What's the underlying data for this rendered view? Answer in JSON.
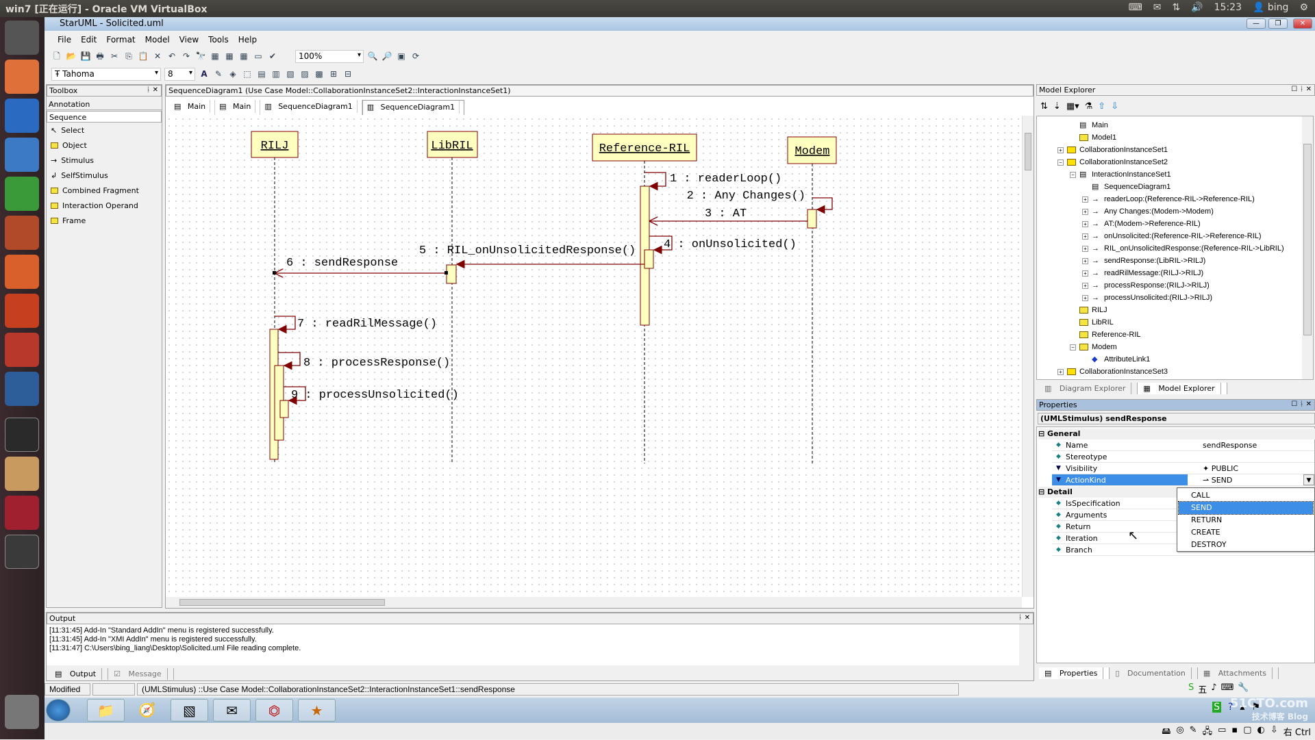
{
  "host": {
    "title": "win7 [正在运行] - Oracle VM VirtualBox",
    "clock": "15:23",
    "user": "bing",
    "host_key": "右 Ctrl"
  },
  "app": {
    "title": "StarUML - Solicited.uml",
    "menu": [
      "File",
      "Edit",
      "Format",
      "Model",
      "View",
      "Tools",
      "Help"
    ],
    "zoom": "100%",
    "font": "Tahoma",
    "font_size": "8"
  },
  "toolbox": {
    "title": "Toolbox",
    "sections": [
      "Annotation",
      "Sequence"
    ],
    "items": [
      "Select",
      "Object",
      "Stimulus",
      "SelfStimulus",
      "Combined Fragment",
      "Interaction Operand",
      "Frame"
    ]
  },
  "diagram": {
    "header": "SequenceDiagram1 (Use Case Model::CollaborationInstanceSet2::InteractionInstanceSet1)",
    "tabs": [
      "Main",
      "Main",
      "SequenceDiagram1",
      "SequenceDiagram1"
    ],
    "lifelines": [
      "RILJ",
      "LibRIL",
      "Reference-RIL",
      "Modem"
    ],
    "messages": [
      "1 : readerLoop()",
      "2 : Any Changes()",
      "3 : AT",
      "4 : onUnsolicited()",
      "5 : RIL_onUnsolicitedResponse()",
      "6 : sendResponse",
      "7 : readRilMessage()",
      "8 : processResponse()",
      "9 : processUnsolicited()"
    ],
    "colors": {
      "line": "#800000",
      "fill": "#ffffc0"
    }
  },
  "output": {
    "title": "Output",
    "lines": [
      "[11:31:45]  Add-In \"Standard AddIn\" menu is registered successfully.",
      "[11:31:45]  Add-In \"XMI AddIn\" menu is registered successfully.",
      "[11:31:47]  C:\\Users\\bing_liang\\Desktop\\Solicited.uml File reading complete."
    ],
    "tabs": [
      "Output",
      "Message"
    ]
  },
  "status": {
    "state": "Modified",
    "path": "(UMLStimulus) ::Use Case Model::CollaborationInstanceSet2::InteractionInstanceSet1::sendResponse"
  },
  "explorer": {
    "title": "Model Explorer",
    "tree": [
      "Main",
      "Model1",
      "CollaborationInstanceSet1",
      "CollaborationInstanceSet2",
      "InteractionInstanceSet1",
      "SequenceDiagram1",
      "readerLoop:(Reference-RIL->Reference-RIL)",
      "Any Changes:(Modem->Modem)",
      "AT:(Modem->Reference-RIL)",
      "onUnsolicited:(Reference-RIL->Reference-RIL)",
      "RIL_onUnsolicitedResponse:(Reference-RIL->LibRIL)",
      "sendResponse:(LibRIL->RILJ)",
      "readRilMessage:(RILJ->RILJ)",
      "processResponse:(RILJ->RILJ)",
      "processUnsolicited:(RILJ->RILJ)",
      "RILJ",
      "LibRIL",
      "Reference-RIL",
      "Modem",
      "AttributeLink1",
      "CollaborationInstanceSet3"
    ],
    "tabs": [
      "Diagram Explorer",
      "Model Explorer"
    ]
  },
  "properties": {
    "title": "Properties",
    "subject": "(UMLStimulus) sendResponse",
    "general": "General",
    "detail": "Detail",
    "rows": [
      {
        "k": "Name",
        "v": "sendResponse"
      },
      {
        "k": "Stereotype",
        "v": ""
      },
      {
        "k": "Visibility",
        "v": "PUBLIC"
      },
      {
        "k": "ActionKind",
        "v": "SEND"
      }
    ],
    "detail_rows": [
      "IsSpecification",
      "Arguments",
      "Return",
      "Iteration",
      "Branch"
    ],
    "action_kind_options": [
      "CALL",
      "SEND",
      "RETURN",
      "CREATE",
      "DESTROY"
    ],
    "selected_option": "SEND",
    "tabs": [
      "Properties",
      "Documentation",
      "Attachments"
    ]
  },
  "watermark": "51CTO.com 技术博客 Blog"
}
